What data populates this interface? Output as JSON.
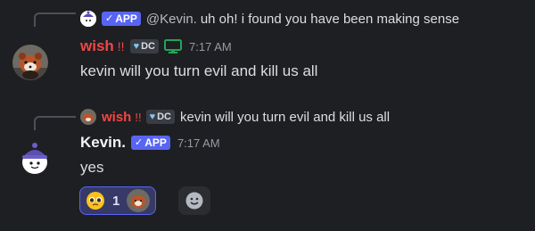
{
  "message1": {
    "reply": {
      "app_badge": "APP",
      "mention": "@Kevin.",
      "text": "uh oh! i found you have been making sense"
    },
    "author": "wish",
    "author_suffix": "!!",
    "tag": "DC",
    "time": "7:17 AM",
    "content": "kevin will you turn evil and kill us all"
  },
  "message2": {
    "reply": {
      "author": "wish",
      "author_suffix": "!!",
      "tag": "DC",
      "text": "kevin will you turn evil and kill us all"
    },
    "author": "Kevin.",
    "app_badge": "APP",
    "time": "7:17 AM",
    "content": "yes",
    "reactions": [
      {
        "emoji": "🥺",
        "count": "1"
      }
    ]
  },
  "colors": {
    "background": "#1e1f22",
    "blurple": "#5865f2",
    "wish_name": "#f04747",
    "monitor_icon": "#23a55a"
  }
}
